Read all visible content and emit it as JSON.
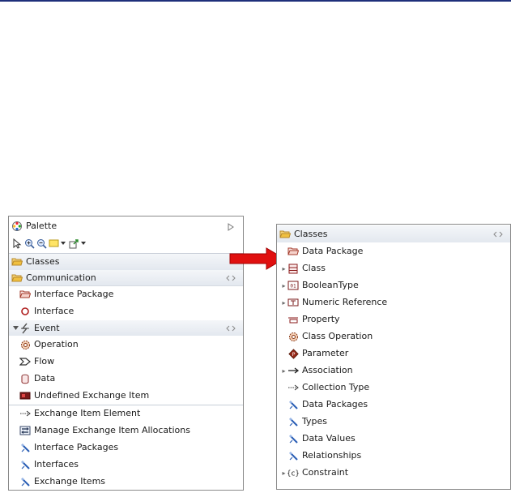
{
  "palette": {
    "title": "Palette",
    "sections": {
      "classes": "Classes",
      "communication": "Communication"
    },
    "items": {
      "interface_package": "Interface Package",
      "interface": "Interface",
      "event": "Event",
      "operation": "Operation",
      "flow": "Flow",
      "data": "Data",
      "undefined_exchange_item": "Undefined Exchange Item",
      "exchange_item_element": "Exchange Item Element",
      "manage_allocations": "Manage Exchange Item Allocations",
      "interface_packages": "Interface Packages",
      "interfaces": "Interfaces",
      "exchange_items": "Exchange Items"
    }
  },
  "classes_panel": {
    "title": "Classes",
    "items": {
      "data_package": "Data Package",
      "class": "Class",
      "boolean_type": "BooleanType",
      "numeric_reference": "Numeric Reference",
      "property": "Property",
      "class_operation": "Class Operation",
      "parameter": "Parameter",
      "association": "Association",
      "collection_type": "Collection Type",
      "data_packages": "Data Packages",
      "types": "Types",
      "data_values": "Data Values",
      "relationships": "Relationships",
      "constraint": "Constraint"
    }
  },
  "colors": {
    "topline": "#1e2f7a",
    "arrow": "#e01010",
    "folder": "#f0c040",
    "filter_blue": "#2b5fb5"
  }
}
